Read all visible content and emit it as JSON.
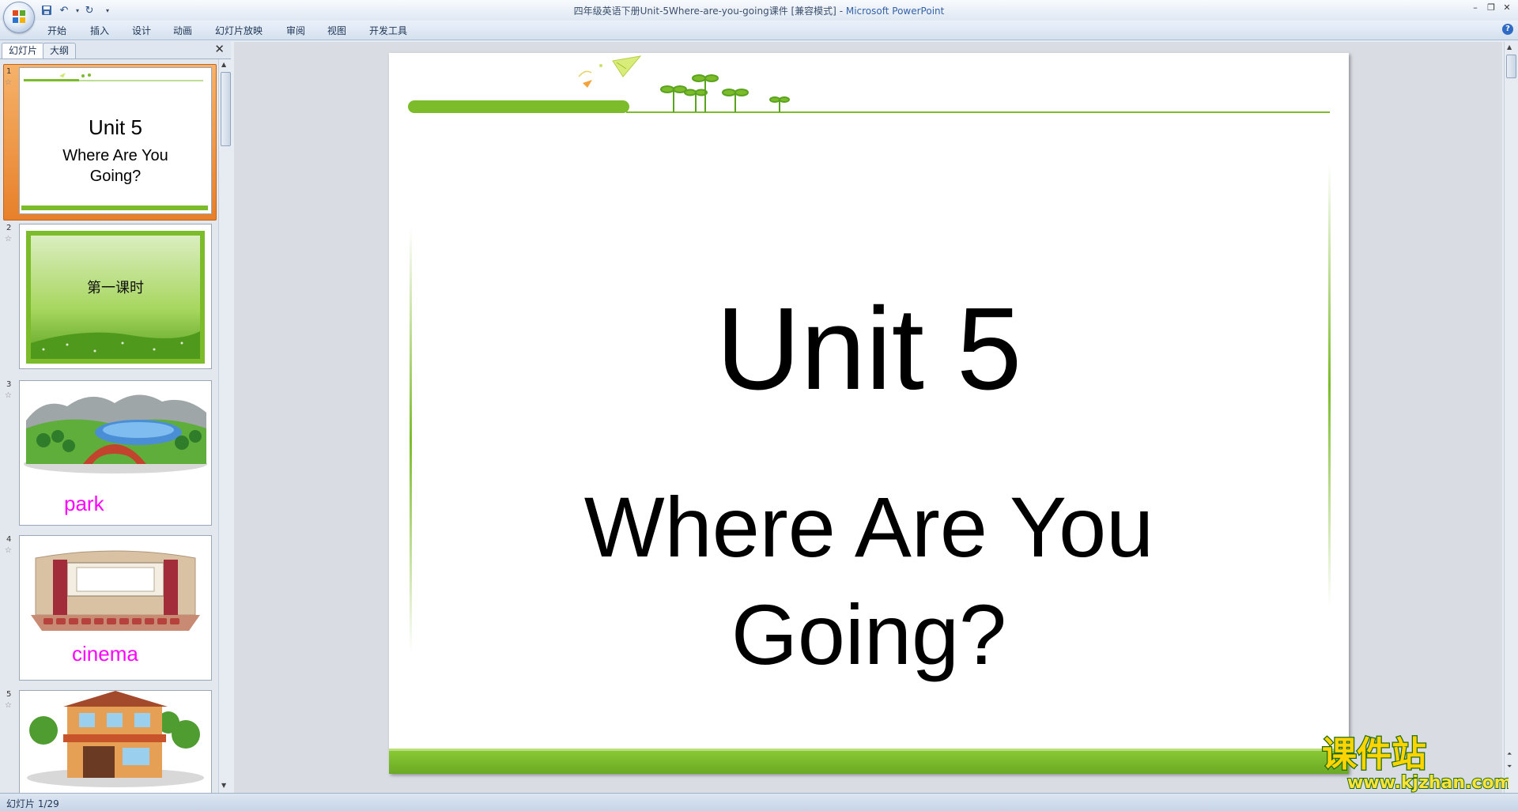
{
  "window": {
    "title_doc": "四年级英语下册Unit-5Where-are-you-going课件 [兼容模式]",
    "title_sep": " - ",
    "title_app": "Microsoft PowerPoint"
  },
  "ribbon": {
    "tabs": [
      "开始",
      "插入",
      "设计",
      "动画",
      "幻灯片放映",
      "审阅",
      "视图",
      "开发工具"
    ]
  },
  "pane": {
    "tab_slides": "幻灯片",
    "tab_outline": "大纲"
  },
  "thumbnails": [
    {
      "num": "1",
      "title": "Unit 5",
      "subtitle_line1": "Where Are You",
      "subtitle_line2": "Going?"
    },
    {
      "num": "2",
      "text": "第一课时"
    },
    {
      "num": "3",
      "word": "park"
    },
    {
      "num": "4",
      "word": "cinema"
    },
    {
      "num": "5"
    }
  ],
  "slide": {
    "title": "Unit 5",
    "subtitle_line1": "Where Are You",
    "subtitle_line2": "Going?"
  },
  "status": {
    "slide_indicator": "幻灯片 1/29"
  },
  "watermark": {
    "cn": "课件站",
    "url": "www.kjzhan.com"
  },
  "colors": {
    "accent_green": "#7cbc2a",
    "word_magenta": "#ff00ff",
    "selection_orange": "#e7802a"
  }
}
